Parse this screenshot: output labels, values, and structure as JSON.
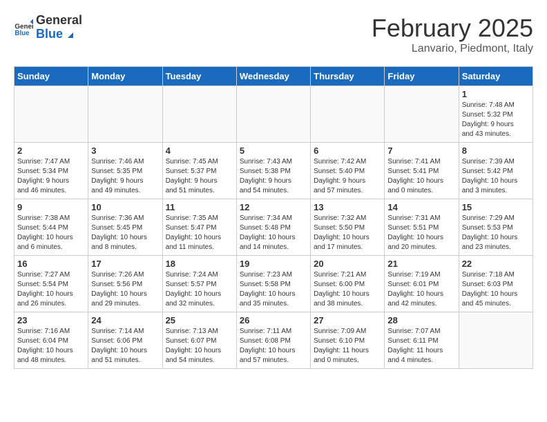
{
  "header": {
    "logo_line1": "General",
    "logo_line2": "Blue",
    "month": "February 2025",
    "location": "Lanvario, Piedmont, Italy"
  },
  "weekdays": [
    "Sunday",
    "Monday",
    "Tuesday",
    "Wednesday",
    "Thursday",
    "Friday",
    "Saturday"
  ],
  "weeks": [
    [
      {
        "day": "",
        "info": ""
      },
      {
        "day": "",
        "info": ""
      },
      {
        "day": "",
        "info": ""
      },
      {
        "day": "",
        "info": ""
      },
      {
        "day": "",
        "info": ""
      },
      {
        "day": "",
        "info": ""
      },
      {
        "day": "1",
        "info": "Sunrise: 7:48 AM\nSunset: 5:32 PM\nDaylight: 9 hours\nand 43 minutes."
      }
    ],
    [
      {
        "day": "2",
        "info": "Sunrise: 7:47 AM\nSunset: 5:34 PM\nDaylight: 9 hours\nand 46 minutes."
      },
      {
        "day": "3",
        "info": "Sunrise: 7:46 AM\nSunset: 5:35 PM\nDaylight: 9 hours\nand 49 minutes."
      },
      {
        "day": "4",
        "info": "Sunrise: 7:45 AM\nSunset: 5:37 PM\nDaylight: 9 hours\nand 51 minutes."
      },
      {
        "day": "5",
        "info": "Sunrise: 7:43 AM\nSunset: 5:38 PM\nDaylight: 9 hours\nand 54 minutes."
      },
      {
        "day": "6",
        "info": "Sunrise: 7:42 AM\nSunset: 5:40 PM\nDaylight: 9 hours\nand 57 minutes."
      },
      {
        "day": "7",
        "info": "Sunrise: 7:41 AM\nSunset: 5:41 PM\nDaylight: 10 hours\nand 0 minutes."
      },
      {
        "day": "8",
        "info": "Sunrise: 7:39 AM\nSunset: 5:42 PM\nDaylight: 10 hours\nand 3 minutes."
      }
    ],
    [
      {
        "day": "9",
        "info": "Sunrise: 7:38 AM\nSunset: 5:44 PM\nDaylight: 10 hours\nand 6 minutes."
      },
      {
        "day": "10",
        "info": "Sunrise: 7:36 AM\nSunset: 5:45 PM\nDaylight: 10 hours\nand 8 minutes."
      },
      {
        "day": "11",
        "info": "Sunrise: 7:35 AM\nSunset: 5:47 PM\nDaylight: 10 hours\nand 11 minutes."
      },
      {
        "day": "12",
        "info": "Sunrise: 7:34 AM\nSunset: 5:48 PM\nDaylight: 10 hours\nand 14 minutes."
      },
      {
        "day": "13",
        "info": "Sunrise: 7:32 AM\nSunset: 5:50 PM\nDaylight: 10 hours\nand 17 minutes."
      },
      {
        "day": "14",
        "info": "Sunrise: 7:31 AM\nSunset: 5:51 PM\nDaylight: 10 hours\nand 20 minutes."
      },
      {
        "day": "15",
        "info": "Sunrise: 7:29 AM\nSunset: 5:53 PM\nDaylight: 10 hours\nand 23 minutes."
      }
    ],
    [
      {
        "day": "16",
        "info": "Sunrise: 7:27 AM\nSunset: 5:54 PM\nDaylight: 10 hours\nand 26 minutes."
      },
      {
        "day": "17",
        "info": "Sunrise: 7:26 AM\nSunset: 5:56 PM\nDaylight: 10 hours\nand 29 minutes."
      },
      {
        "day": "18",
        "info": "Sunrise: 7:24 AM\nSunset: 5:57 PM\nDaylight: 10 hours\nand 32 minutes."
      },
      {
        "day": "19",
        "info": "Sunrise: 7:23 AM\nSunset: 5:58 PM\nDaylight: 10 hours\nand 35 minutes."
      },
      {
        "day": "20",
        "info": "Sunrise: 7:21 AM\nSunset: 6:00 PM\nDaylight: 10 hours\nand 38 minutes."
      },
      {
        "day": "21",
        "info": "Sunrise: 7:19 AM\nSunset: 6:01 PM\nDaylight: 10 hours\nand 42 minutes."
      },
      {
        "day": "22",
        "info": "Sunrise: 7:18 AM\nSunset: 6:03 PM\nDaylight: 10 hours\nand 45 minutes."
      }
    ],
    [
      {
        "day": "23",
        "info": "Sunrise: 7:16 AM\nSunset: 6:04 PM\nDaylight: 10 hours\nand 48 minutes."
      },
      {
        "day": "24",
        "info": "Sunrise: 7:14 AM\nSunset: 6:06 PM\nDaylight: 10 hours\nand 51 minutes."
      },
      {
        "day": "25",
        "info": "Sunrise: 7:13 AM\nSunset: 6:07 PM\nDaylight: 10 hours\nand 54 minutes."
      },
      {
        "day": "26",
        "info": "Sunrise: 7:11 AM\nSunset: 6:08 PM\nDaylight: 10 hours\nand 57 minutes."
      },
      {
        "day": "27",
        "info": "Sunrise: 7:09 AM\nSunset: 6:10 PM\nDaylight: 11 hours\nand 0 minutes."
      },
      {
        "day": "28",
        "info": "Sunrise: 7:07 AM\nSunset: 6:11 PM\nDaylight: 11 hours\nand 4 minutes."
      },
      {
        "day": "",
        "info": ""
      }
    ]
  ]
}
